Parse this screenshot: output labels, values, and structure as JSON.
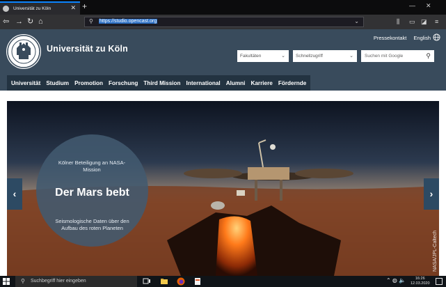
{
  "browser": {
    "tab_title": "Universität zu Köln",
    "tab_close": "✕",
    "new_tab": "+",
    "url": "https://studio.opencast.org",
    "window_minimize": "—",
    "window_close": "✕"
  },
  "header": {
    "university_name": "Universität zu Köln",
    "top_links": [
      "Pressekontakt",
      "English"
    ],
    "dropdowns": {
      "faculties": "Fakultäten",
      "quick_access": "Schnellzugriff"
    },
    "search_placeholder": "Suchen mit Google"
  },
  "menu": {
    "items": [
      "Universität",
      "Studium",
      "Promotion",
      "Forschung",
      "Third Mission",
      "International",
      "Alumni",
      "Karriere",
      "Fördernde"
    ]
  },
  "hero": {
    "kicker": "Kölner Beteiligung an NASA-Mission",
    "headline": "Der Mars bebt",
    "subline": "Seismologische Daten über den Aufbau des roten Planeten",
    "credit": "NASA/JPL-Caltech",
    "prev_arrow": "‹",
    "next_arrow": "›"
  },
  "taskbar": {
    "search_placeholder": "Suchbegriff hier eingeben",
    "time": "16:26",
    "date": "12.03.2020"
  },
  "colors": {
    "header_bg": "#394b5c",
    "menu_bg": "#233341",
    "accent_blue": "#0a84ff"
  }
}
